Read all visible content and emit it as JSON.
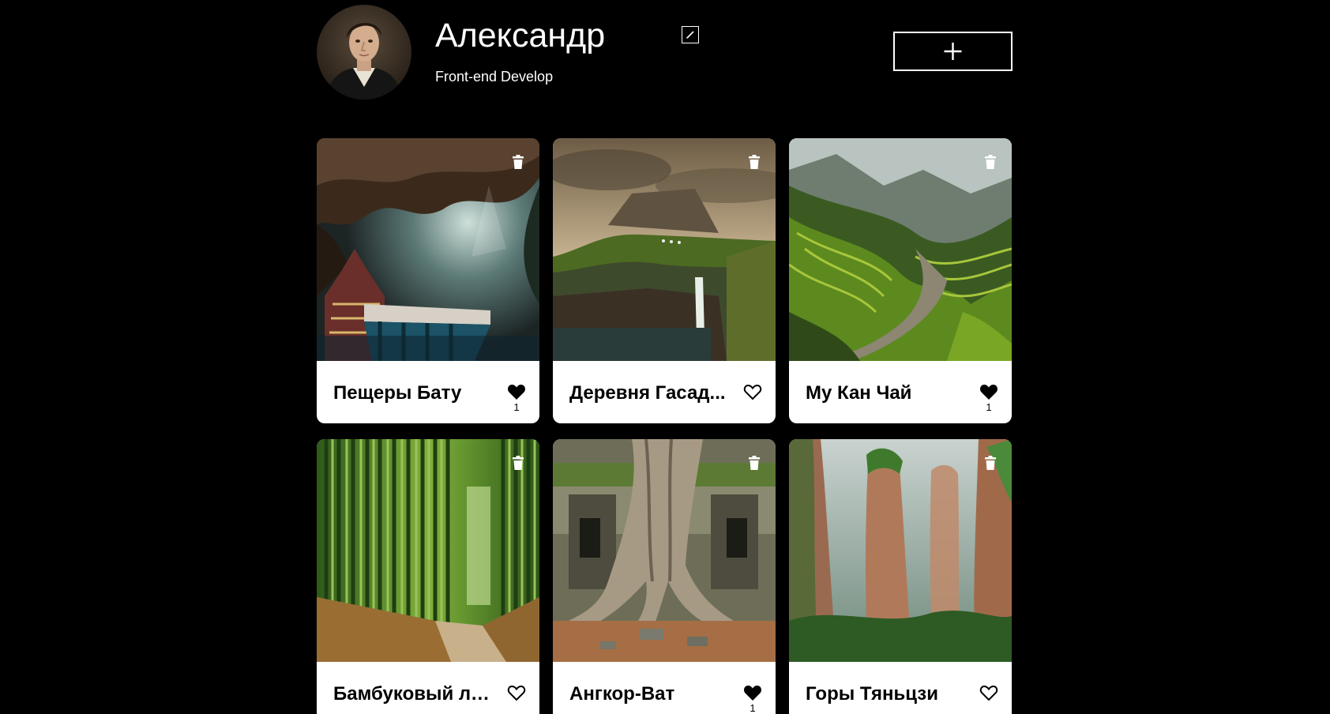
{
  "profile": {
    "name": "Александр",
    "about": "Front-end Develop"
  },
  "cards": [
    {
      "title": "Пещеры Бату",
      "liked": true,
      "likes": "1",
      "photo": "cave"
    },
    {
      "title": "Деревня Гасад...",
      "liked": false,
      "likes": "",
      "photo": "cliff"
    },
    {
      "title": "Му Кан Чай",
      "liked": true,
      "likes": "1",
      "photo": "terraces"
    },
    {
      "title": "Бамбуковый лес",
      "liked": false,
      "likes": "",
      "photo": "bamboo"
    },
    {
      "title": "Ангкор-Ват",
      "liked": true,
      "likes": "1",
      "photo": "temple"
    },
    {
      "title": "Горы Тяньцзи",
      "liked": false,
      "likes": "",
      "photo": "pillars"
    }
  ]
}
